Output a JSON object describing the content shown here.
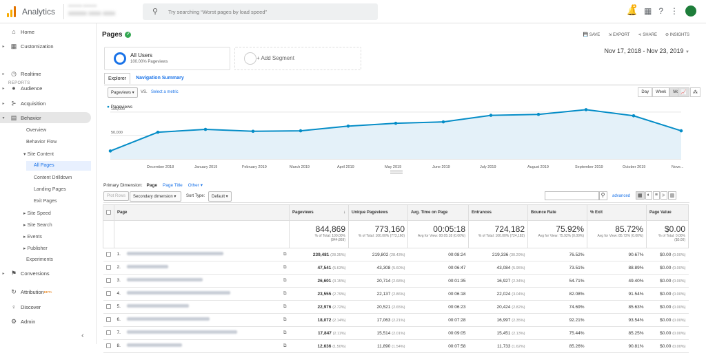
{
  "app": {
    "name": "Analytics",
    "search_placeholder": "Try searching “Worst pages by load speed”",
    "notif_count": "1"
  },
  "sidebar": {
    "home": "Home",
    "customization": "Customization",
    "reports_label": "REPORTS",
    "realtime": "Realtime",
    "audience": "Audience",
    "acquisition": "Acquisition",
    "behavior": "Behavior",
    "overview": "Overview",
    "behavior_flow": "Behavior Flow",
    "site_content": "Site Content",
    "all_pages": "All Pages",
    "content_drilldown": "Content Drilldown",
    "landing_pages": "Landing Pages",
    "exit_pages": "Exit Pages",
    "site_speed": "Site Speed",
    "site_search": "Site Search",
    "events": "Events",
    "publisher": "Publisher",
    "experiments": "Experiments",
    "conversions": "Conversions",
    "attribution": "Attribution",
    "beta": "BETA",
    "discover": "Discover",
    "admin": "Admin"
  },
  "header": {
    "title": "Pages",
    "save": "SAVE",
    "export": "EXPORT",
    "share": "SHARE",
    "insights": "INSIGHTS"
  },
  "segment": {
    "name": "All Users",
    "sub": "100.00% Pageviews",
    "add": "+ Add Segment"
  },
  "date_range": "Nov 17, 2018 - Nov 23, 2019",
  "tabs": {
    "explorer": "Explorer",
    "nav_summary": "Navigation Summary"
  },
  "controls": {
    "metric": "Pageviews",
    "vs": "VS.",
    "select_metric": "Select a metric",
    "day": "Day",
    "week": "Week",
    "month": "Month"
  },
  "chart_data": {
    "type": "line",
    "series": [
      {
        "name": "Pageviews",
        "values": [
          17000,
          57000,
          63000,
          59000,
          60000,
          70000,
          76000,
          79000,
          93000,
          95000,
          105000,
          92000,
          60000
        ]
      }
    ],
    "x": [
      "Nov 2018",
      "Dec 2018",
      "Jan 2019",
      "Feb 2019",
      "Mar 2019",
      "Apr 2019",
      "May 2019",
      "Jun 2019",
      "Jul 2019",
      "Aug 2019",
      "Sep 2019",
      "Oct 2019",
      "Nov 2019"
    ],
    "tick_labels": [
      "December 2018",
      "January 2019",
      "February 2019",
      "March 2019",
      "April 2019",
      "May 2019",
      "June 2019",
      "July 2019",
      "August 2019",
      "September 2019",
      "October 2019",
      "Nove..."
    ],
    "y_ticks": [
      "100,000",
      "50,000"
    ],
    "ylim": [
      0,
      110000
    ],
    "grid": true,
    "color": "#058dc7"
  },
  "table_controls": {
    "primary_dimension": "Primary Dimension:",
    "page": "Page",
    "page_title": "Page Title",
    "other": "Other",
    "plot_rows": "Plot Rows",
    "secondary": "Secondary dimension",
    "sort_type": "Sort Type:",
    "sort_default": "Default",
    "advanced": "advanced"
  },
  "columns": [
    "Page",
    "Pageviews",
    "Unique Pageviews",
    "Avg. Time on Page",
    "Entrances",
    "Bounce Rate",
    "% Exit",
    "Page Value"
  ],
  "totals": [
    {
      "v": "844,869",
      "s1": "% of Total: 100.00%",
      "s2": "(844,869)"
    },
    {
      "v": "773,160",
      "s1": "% of Total: 100.00% (773,160)",
      "s2": ""
    },
    {
      "v": "00:05:18",
      "s1": "Avg for View: 00:05:18 (0.00%)",
      "s2": ""
    },
    {
      "v": "724,182",
      "s1": "% of Total: 100.00% (724,182)",
      "s2": ""
    },
    {
      "v": "75.92%",
      "s1": "Avg for View: 75.92% (0.00%)",
      "s2": ""
    },
    {
      "v": "85.72%",
      "s1": "Avg for View: 85.72% (0.00%)",
      "s2": ""
    },
    {
      "v": "$0.00",
      "s1": "% of Total: 0.00% ($0.00)",
      "s2": ""
    }
  ],
  "rows": [
    {
      "n": "1.",
      "pv": "239,481",
      "pvp": "(28.35%)",
      "upv": "219,802",
      "upvp": "(28.43%)",
      "t": "00:08:24",
      "e": "219,336",
      "ep": "(30.29%)",
      "b": "76.52%",
      "x": "90.67%",
      "val": "$0.00",
      "valp": "(0.00%)"
    },
    {
      "n": "2.",
      "pv": "47,541",
      "pvp": "(5.63%)",
      "upv": "43,308",
      "upvp": "(5.60%)",
      "t": "00:06:47",
      "e": "43,084",
      "ep": "(5.95%)",
      "b": "73.51%",
      "x": "88.89%",
      "val": "$0.00",
      "valp": "(0.00%)"
    },
    {
      "n": "3.",
      "pv": "26,601",
      "pvp": "(3.15%)",
      "upv": "20,714",
      "upvp": "(2.68%)",
      "t": "00:01:35",
      "e": "16,927",
      "ep": "(2.34%)",
      "b": "54.71%",
      "x": "49.40%",
      "val": "$0.00",
      "valp": "(0.00%)"
    },
    {
      "n": "4.",
      "pv": "23,555",
      "pvp": "(2.79%)",
      "upv": "22,137",
      "upvp": "(2.86%)",
      "t": "00:06:18",
      "e": "22,024",
      "ep": "(3.04%)",
      "b": "82.08%",
      "x": "91.54%",
      "val": "$0.00",
      "valp": "(0.00%)"
    },
    {
      "n": "5.",
      "pv": "22,976",
      "pvp": "(2.72%)",
      "upv": "20,521",
      "upvp": "(2.65%)",
      "t": "00:06:23",
      "e": "20,424",
      "ep": "(2.82%)",
      "b": "74.69%",
      "x": "85.63%",
      "val": "$0.00",
      "valp": "(0.00%)"
    },
    {
      "n": "6.",
      "pv": "18,072",
      "pvp": "(2.14%)",
      "upv": "17,063",
      "upvp": "(2.21%)",
      "t": "00:07:28",
      "e": "16,997",
      "ep": "(2.35%)",
      "b": "92.21%",
      "x": "93.54%",
      "val": "$0.00",
      "valp": "(0.00%)"
    },
    {
      "n": "7.",
      "pv": "17,847",
      "pvp": "(2.11%)",
      "upv": "15,514",
      "upvp": "(2.01%)",
      "t": "00:09:05",
      "e": "15,451",
      "ep": "(2.13%)",
      "b": "75.44%",
      "x": "85.25%",
      "val": "$0.00",
      "valp": "(0.00%)"
    },
    {
      "n": "8.",
      "pv": "12,636",
      "pvp": "(1.50%)",
      "upv": "11,890",
      "upvp": "(1.54%)",
      "t": "00:07:58",
      "e": "11,733",
      "ep": "(1.62%)",
      "b": "85.26%",
      "x": "90.81%",
      "val": "$0.00",
      "valp": "(0.00%)"
    }
  ]
}
